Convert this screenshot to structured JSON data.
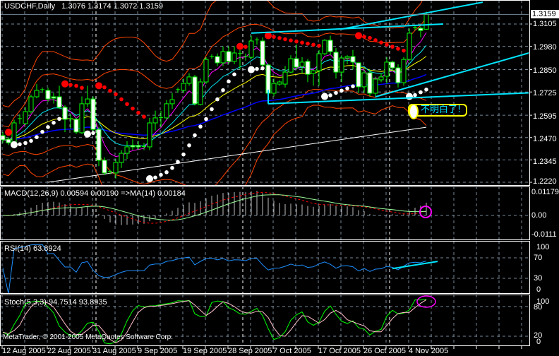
{
  "window": {
    "symbol_timeframe": "USDCHF,Daily",
    "ohlc_readout": "1.3076 1.3174 1.3072 1.3159"
  },
  "price_axis": {
    "ticks": [
      "1.3105",
      "1.2980",
      "1.2850",
      "1.2725",
      "1.2595",
      "1.2470",
      "1.2345",
      "1.2220"
    ],
    "current_price": "1.3159"
  },
  "macd": {
    "header": "MACD(12,26,9) 0.00594 0.00190  =>MA(14) 0.00184",
    "ticks": [
      "0.01179",
      "0.00",
      "-0.0111"
    ]
  },
  "rsi": {
    "header": "RSI(14) 63.8924",
    "ticks": [
      "100",
      "70",
      "30",
      "0"
    ]
  },
  "stoch": {
    "header": "Stoch(5,3,3) 94.7514 93.8935",
    "ticks": [
      "100",
      "80",
      "20",
      "0"
    ]
  },
  "date_axis": {
    "labels": [
      "12 Aug 2005",
      "22 Aug 2005",
      "31 Aug 2005",
      "9 Sep 2005",
      "19 Sep 2005",
      "28 Sep 2005",
      "7 Oct 2005",
      "17 Oct 2005",
      "26 Oct 2005",
      "4 Nov 2005"
    ]
  },
  "watermark": "MetaTrader, © 2001-2005 MetaQuotes Software Corp.",
  "annotation": {
    "text": "不明白了!"
  },
  "colors": {
    "background": "#000000",
    "grid": "#778899",
    "bull_outline": "#00ff00",
    "bear_body": "#ffffff",
    "bollinger": "#ff4500",
    "ma_yellow": "#ffff00",
    "ma_cyan": "#00e5ee",
    "ma_magenta": "#ff00ff",
    "ma_blue": "#0000ff",
    "long_ma": "#ffffff",
    "sar_up": "#ffffff",
    "sar_down": "#ff0000",
    "trendline": "#00e5ff",
    "macd_hist": "#c0c0c0",
    "macd_signal": "#ff0000",
    "macd_ma": "#98fb98",
    "rsi": "#1e90ff",
    "stoch_main": "#00ff00",
    "stoch_signal": "#ffc0cb",
    "highlight_circle": "#ff00ff",
    "annotation_border": "#ffff00"
  },
  "chart_data": {
    "type": "candlestick",
    "symbol": "USDCHF",
    "timeframe": "Daily",
    "ylim": [
      1.2204,
      1.3239
    ],
    "grid": true,
    "candles_columns": [
      "date",
      "open",
      "high",
      "low",
      "close"
    ],
    "candles": [
      [
        "2005-08-12",
        1.2481,
        1.25,
        1.244,
        1.2457
      ],
      [
        "2005-08-14",
        1.2461,
        1.247,
        1.243,
        1.2441
      ],
      [
        "2005-08-15",
        1.2441,
        1.257,
        1.243,
        1.2552
      ],
      [
        "2005-08-16",
        1.2576,
        1.26,
        1.2545,
        1.2572
      ],
      [
        "2005-08-17",
        1.2548,
        1.264,
        1.254,
        1.2615
      ],
      [
        "2005-08-18",
        1.2615,
        1.271,
        1.2605,
        1.2698
      ],
      [
        "2005-08-19",
        1.2698,
        1.277,
        1.269,
        1.2734
      ],
      [
        "2005-08-21",
        1.2734,
        1.275,
        1.272,
        1.2738
      ],
      [
        "2005-08-22",
        1.2734,
        1.275,
        1.267,
        1.2686
      ],
      [
        "2005-08-23",
        1.2698,
        1.272,
        1.266,
        1.269
      ],
      [
        "2005-08-24",
        1.2698,
        1.276,
        1.263,
        1.2639
      ],
      [
        "2005-08-25",
        1.2639,
        1.265,
        1.25,
        1.2572
      ],
      [
        "2005-08-26",
        1.2576,
        1.26,
        1.252,
        1.2572
      ],
      [
        "2005-08-28",
        1.2572,
        1.258,
        1.249,
        1.2501
      ],
      [
        "2005-08-29",
        1.2497,
        1.27,
        1.249,
        1.2659
      ],
      [
        "2005-08-30",
        1.2659,
        1.276,
        1.264,
        1.2686
      ],
      [
        "2005-08-31",
        1.2686,
        1.27,
        1.25,
        1.2516
      ],
      [
        "2005-09-01",
        1.2516,
        1.253,
        1.231,
        1.2343
      ],
      [
        "2005-09-02",
        1.2343,
        1.236,
        1.226,
        1.2272
      ],
      [
        "2005-09-04",
        1.2276,
        1.229,
        1.2265,
        1.228
      ],
      [
        "2005-09-05",
        1.2272,
        1.235,
        1.224,
        1.2331
      ],
      [
        "2005-09-06",
        1.2331,
        1.24,
        1.23,
        1.2382
      ],
      [
        "2005-09-07",
        1.2382,
        1.245,
        1.235,
        1.2418
      ],
      [
        "2005-09-08",
        1.2426,
        1.246,
        1.24,
        1.2418
      ],
      [
        "2005-09-09",
        1.2426,
        1.245,
        1.24,
        1.2418
      ],
      [
        "2005-09-11",
        1.2418,
        1.244,
        1.24,
        1.242
      ],
      [
        "2005-09-12",
        1.2418,
        1.258,
        1.24,
        1.2552
      ],
      [
        "2005-09-13",
        1.2552,
        1.262,
        1.251,
        1.258
      ],
      [
        "2005-09-14",
        1.258,
        1.262,
        1.253,
        1.2582
      ],
      [
        "2005-09-15",
        1.258,
        1.268,
        1.257,
        1.2659
      ],
      [
        "2005-09-16",
        1.2659,
        1.272,
        1.263,
        1.2682
      ],
      [
        "2005-09-18",
        1.2736,
        1.275,
        1.272,
        1.2738
      ],
      [
        "2005-09-19",
        1.2734,
        1.28,
        1.272,
        1.2773
      ],
      [
        "2005-09-20",
        1.2773,
        1.283,
        1.276,
        1.2809
      ],
      [
        "2005-09-21",
        1.2809,
        1.282,
        1.265,
        1.2659
      ],
      [
        "2005-09-22",
        1.2655,
        1.28,
        1.265,
        1.2781
      ],
      [
        "2005-09-23",
        1.2781,
        1.292,
        1.277,
        1.2907
      ],
      [
        "2005-09-25",
        1.2923,
        1.2935,
        1.291,
        1.2925
      ],
      [
        "2005-09-26",
        1.2923,
        1.294,
        1.287,
        1.2888
      ],
      [
        "2005-09-27",
        1.2888,
        1.298,
        1.287,
        1.2951
      ],
      [
        "2005-09-28",
        1.2951,
        1.298,
        1.288,
        1.2896
      ],
      [
        "2005-09-29",
        1.2896,
        1.298,
        1.288,
        1.2943
      ],
      [
        "2005-09-30",
        1.2935,
        1.296,
        1.285,
        1.294
      ],
      [
        "2005-10-02",
        1.2923,
        1.294,
        1.29,
        1.2925
      ],
      [
        "2005-10-03",
        1.2919,
        1.304,
        1.291,
        1.301
      ],
      [
        "2005-10-04",
        1.3014,
        1.303,
        1.299,
        1.3016
      ],
      [
        "2005-10-05",
        1.301,
        1.303,
        1.286,
        1.2876
      ],
      [
        "2005-10-06",
        1.2876,
        1.288,
        1.27,
        1.2718
      ],
      [
        "2005-10-07",
        1.2718,
        1.28,
        1.27,
        1.2773
      ],
      [
        "2005-10-09",
        1.2769,
        1.279,
        1.276,
        1.2781
      ],
      [
        "2005-10-10",
        1.2769,
        1.287,
        1.275,
        1.2836
      ],
      [
        "2005-10-11",
        1.2836,
        1.293,
        1.283,
        1.2911
      ],
      [
        "2005-10-12",
        1.2911,
        1.299,
        1.285,
        1.2864
      ],
      [
        "2005-10-13",
        1.2868,
        1.292,
        1.283,
        1.2892
      ],
      [
        "2005-10-14",
        1.2896,
        1.291,
        1.278,
        1.2824
      ],
      [
        "2005-10-16",
        1.2828,
        1.285,
        1.276,
        1.2844
      ],
      [
        "2005-10-17",
        1.2844,
        1.296,
        1.276,
        1.2939
      ],
      [
        "2005-10-18",
        1.2939,
        1.302,
        1.293,
        1.3014
      ],
      [
        "2005-10-19",
        1.3014,
        1.304,
        1.293,
        1.2951
      ],
      [
        "2005-10-20",
        1.2947,
        1.297,
        1.28,
        1.2836
      ],
      [
        "2005-10-21",
        1.2836,
        1.293,
        1.278,
        1.2915
      ],
      [
        "2005-10-23",
        1.2915,
        1.293,
        1.288,
        1.2923
      ],
      [
        "2005-10-24",
        1.2923,
        1.296,
        1.285,
        1.2892
      ],
      [
        "2005-10-25",
        1.2888,
        1.289,
        1.272,
        1.2754
      ],
      [
        "2005-10-26",
        1.2754,
        1.285,
        1.272,
        1.2832
      ],
      [
        "2005-10-27",
        1.2832,
        1.285,
        1.27,
        1.2718
      ],
      [
        "2005-10-28",
        1.2718,
        1.281,
        1.27,
        1.2797
      ],
      [
        "2005-10-30",
        1.2793,
        1.283,
        1.278,
        1.2809
      ],
      [
        "2005-10-31",
        1.2813,
        1.292,
        1.277,
        1.2892
      ],
      [
        "2005-11-01",
        1.2892,
        1.29,
        1.284,
        1.286
      ],
      [
        "2005-11-02",
        1.286,
        1.288,
        1.275,
        1.2777
      ],
      [
        "2005-11-03",
        1.2777,
        1.292,
        1.276,
        1.2907
      ],
      [
        "2005-11-04",
        1.2907,
        1.308,
        1.29,
        1.3054
      ],
      [
        "2005-11-06",
        1.3085,
        1.31,
        1.307,
        1.3087
      ],
      [
        "2005-11-07",
        1.3081,
        1.309,
        1.303,
        1.3069
      ],
      [
        "2005-11-08",
        1.3076,
        1.3174,
        1.3072,
        1.3159
      ]
    ],
    "long_ma": [
      [
        "2005-08-22",
        1.222
      ],
      [
        "2005-11-08",
        1.2528
      ]
    ],
    "trendlines": [
      {
        "from": [
          "2005-10-03",
          1.3054
        ],
        "to": [
          "2005-11-12",
          1.3105
        ]
      },
      {
        "from": [
          "2005-10-21",
          1.3077
        ],
        "to": [
          "2005-11-20",
          1.3227
        ]
      },
      {
        "from": [
          "2005-10-06",
          1.2738
        ],
        "to": [
          "2005-10-06",
          1.2659
        ]
      },
      {
        "from": [
          "2005-10-06",
          1.2659
        ],
        "to": [
          "2005-12-08",
          1.273
        ]
      },
      {
        "from": [
          "2005-10-28",
          1.2698
        ],
        "to": [
          "2005-12-08",
          1.3014
        ]
      }
    ],
    "rsi_trendline": {
      "from": [
        "2005-11-01",
        49
      ],
      "to": [
        "2005-11-09",
        63
      ]
    },
    "annotation_anchor": [
      "2005-11-03",
      1.2625
    ]
  }
}
